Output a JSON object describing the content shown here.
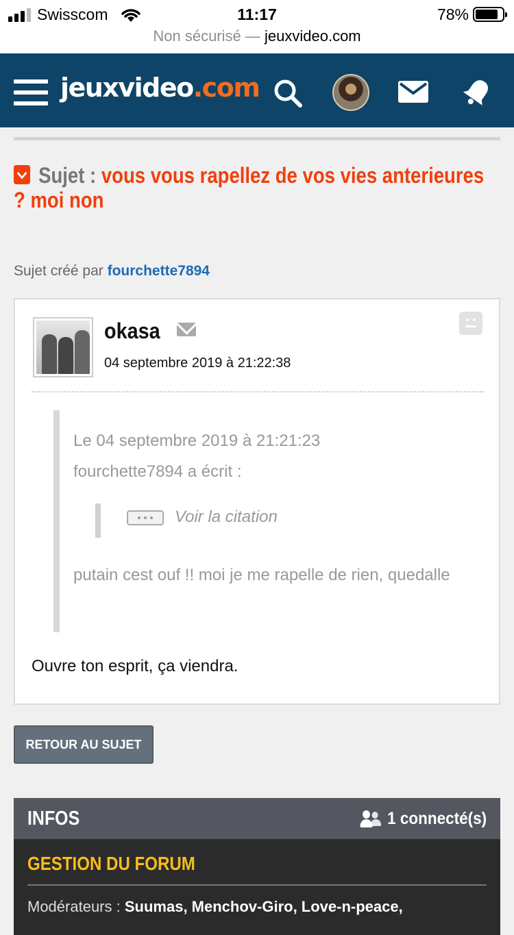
{
  "status_bar": {
    "carrier": "Swisscom",
    "time": "11:17",
    "battery": "78%",
    "battery_level": 0.78,
    "signal_bars": 3,
    "security_label": "Non sécurisé —",
    "domain": "jeuxvideo.com"
  },
  "header": {
    "logo_main": "jeuxvideo",
    "logo_suffix": ".com",
    "icons": [
      "menu-icon",
      "search-icon",
      "user-avatar",
      "mail-icon",
      "notification-bell-icon"
    ],
    "colors": {
      "background": "#0e4467",
      "accent": "#f36c20"
    }
  },
  "topic": {
    "label": "Sujet :",
    "title": "vous vous rapellez de vos vies anterieures ? moi non",
    "created_by_label": "Sujet créé par",
    "created_by": "fourchette7894",
    "title_color": "#f23f0c"
  },
  "post": {
    "author": "okasa",
    "date": "04 septembre 2019 à 21:22:38",
    "quote": {
      "date_line": "Le 04 septembre 2019 à 21:21:23",
      "author_line": "fourchette7894 a écrit :",
      "nested_label": "Voir la citation",
      "text": "putain cest ouf !! moi je me rapelle de rien, quedalle"
    },
    "message": "Ouvre ton esprit, ça viendra."
  },
  "actions": {
    "back_label": "RETOUR AU SUJET"
  },
  "infos": {
    "title": "INFOS",
    "connected": "1 connecté(s)",
    "section_title": "GESTION DU FORUM",
    "moderators_label": "Modérateurs :",
    "moderators": "Suumas, Menchov-Giro, Love-n-peace,"
  }
}
